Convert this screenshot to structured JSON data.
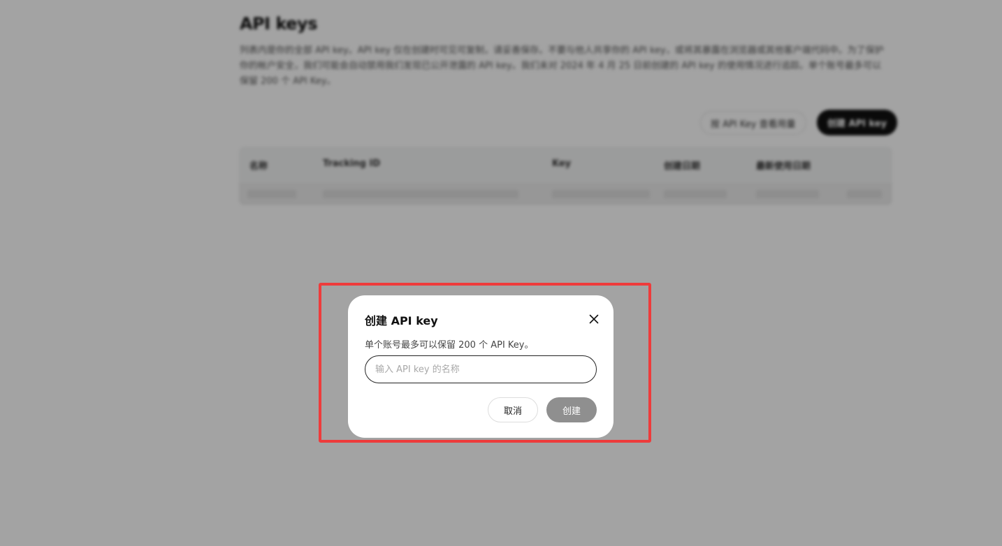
{
  "page": {
    "title": "API keys",
    "description": "列表内是你的全部 API key。API key 仅在创建时可见可复制，请妥善保存。不要与他人共享你的 API key，或将其暴露在浏览器或其他客户端代码中。为了保护你的帐户安全，我们可能会自动禁用我们发现已公开泄露的 API key。我们未对 2024 年 4 月 25 日前创建的 API key 的使用情况进行追踪。单个账号最多可以保留 200 个 API Key。",
    "usage_button": "按 API Key 查看用量",
    "create_button": "创建 API key"
  },
  "table": {
    "headers": [
      "名称",
      "Tracking ID",
      "Key",
      "创建日期",
      "最新使用日期"
    ]
  },
  "dialog": {
    "title": "创建 API key",
    "description": "单个账号最多可以保留 200 个 API Key。",
    "input_placeholder": "输入 API key 的名称",
    "input_value": "",
    "cancel_label": "取消",
    "confirm_label": "创建",
    "close_icon": "close-icon"
  },
  "colors": {
    "highlight": "#ee3b3b",
    "confirm_disabled": "#8f8f8f",
    "primary": "#111111"
  }
}
